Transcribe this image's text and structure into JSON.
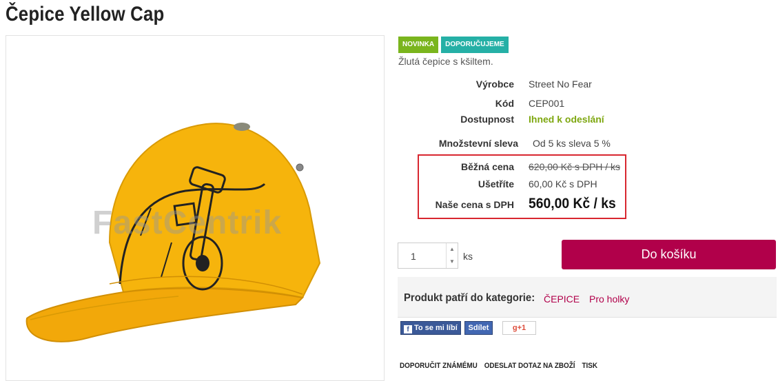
{
  "product": {
    "title": "Čepice Yellow Cap",
    "watermark": "FastCentrik",
    "badges": [
      {
        "label": "NOVINKA",
        "color": "#7ab51d"
      },
      {
        "label": "DOPORUČUJEME",
        "color": "#25b0a6"
      }
    ],
    "description": "Žlutá čepice s kšiltem.",
    "manufacturer_label": "Výrobce",
    "manufacturer": "Street No Fear",
    "code_label": "Kód",
    "code": "CEP001",
    "availability_label": "Dostupnost",
    "availability": "Ihned k odeslání",
    "discount_label": "Množstevní sleva",
    "discount": "Od 5 ks sleva 5 %"
  },
  "pricing": {
    "regular_label": "Běžná cena",
    "regular": "620,00 Kč s DPH / ks",
    "save_label": "Ušetříte",
    "save": "60,00 Kč s DPH",
    "our_label": "Naše cena s DPH",
    "our": "560,00 Kč / ks"
  },
  "cart": {
    "quantity": "1",
    "unit": "ks",
    "button": "Do košíku"
  },
  "category": {
    "label": "Produkt patří do kategorie:",
    "links": [
      "ČEPICE",
      "Pro holky"
    ]
  },
  "social": {
    "like": "To se mi líbí",
    "share": "Sdílet",
    "gplus": "+1"
  },
  "footer_links": [
    "DOPORUČIT ZNÁMÉMU",
    "ODESLAT DOTAZ NA ZBOŽÍ",
    "TISK"
  ],
  "colors": {
    "accent": "#b1004a",
    "highlight": "#d8262f",
    "available": "#7ea710"
  }
}
